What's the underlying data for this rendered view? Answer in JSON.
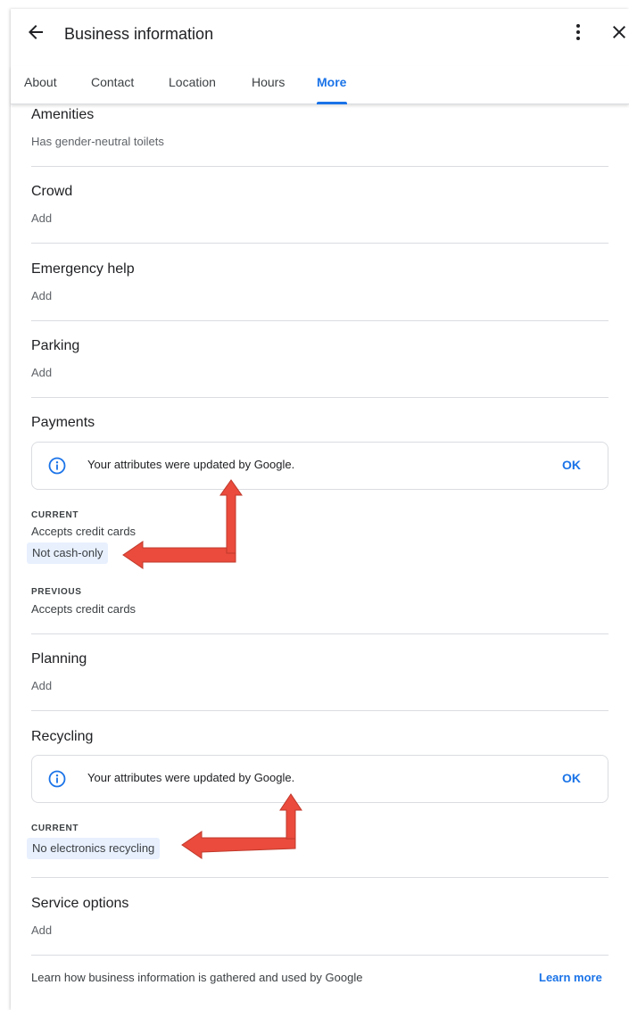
{
  "header": {
    "title": "Business information",
    "back_icon": "arrow-left-icon",
    "menu_icon": "more-vert-icon",
    "close_icon": "close-icon"
  },
  "tabs": [
    {
      "label": "About"
    },
    {
      "label": "Contact"
    },
    {
      "label": "Location"
    },
    {
      "label": "Hours"
    },
    {
      "label": "More",
      "active": true
    }
  ],
  "sections": {
    "amenities": {
      "title": "Amenities",
      "value": "Has gender-neutral toilets"
    },
    "crowd": {
      "title": "Crowd",
      "action": "Add"
    },
    "emergency": {
      "title": "Emergency help",
      "action": "Add"
    },
    "parking": {
      "title": "Parking",
      "action": "Add"
    },
    "payments": {
      "title": "Payments",
      "notice": {
        "text": "Your attributes were updated by Google.",
        "ok": "OK"
      },
      "current_label": "CURRENT",
      "current_values": [
        "Accepts credit cards",
        "Not cash-only"
      ],
      "previous_label": "PREVIOUS",
      "previous_values": [
        "Accepts credit cards"
      ]
    },
    "planning": {
      "title": "Planning",
      "action": "Add"
    },
    "recycling": {
      "title": "Recycling",
      "notice": {
        "text": "Your attributes were updated by Google.",
        "ok": "OK"
      },
      "current_label": "CURRENT",
      "current_values": [
        "No electronics recycling"
      ]
    },
    "service_options": {
      "title": "Service options",
      "action": "Add"
    }
  },
  "footer": {
    "text": "Learn how business information is gathered and used by Google",
    "link": "Learn more"
  },
  "colors": {
    "accent": "#1a73e8",
    "annotation_arrow": "#ea4b3c",
    "highlight_chip": "#e8f0fe"
  }
}
